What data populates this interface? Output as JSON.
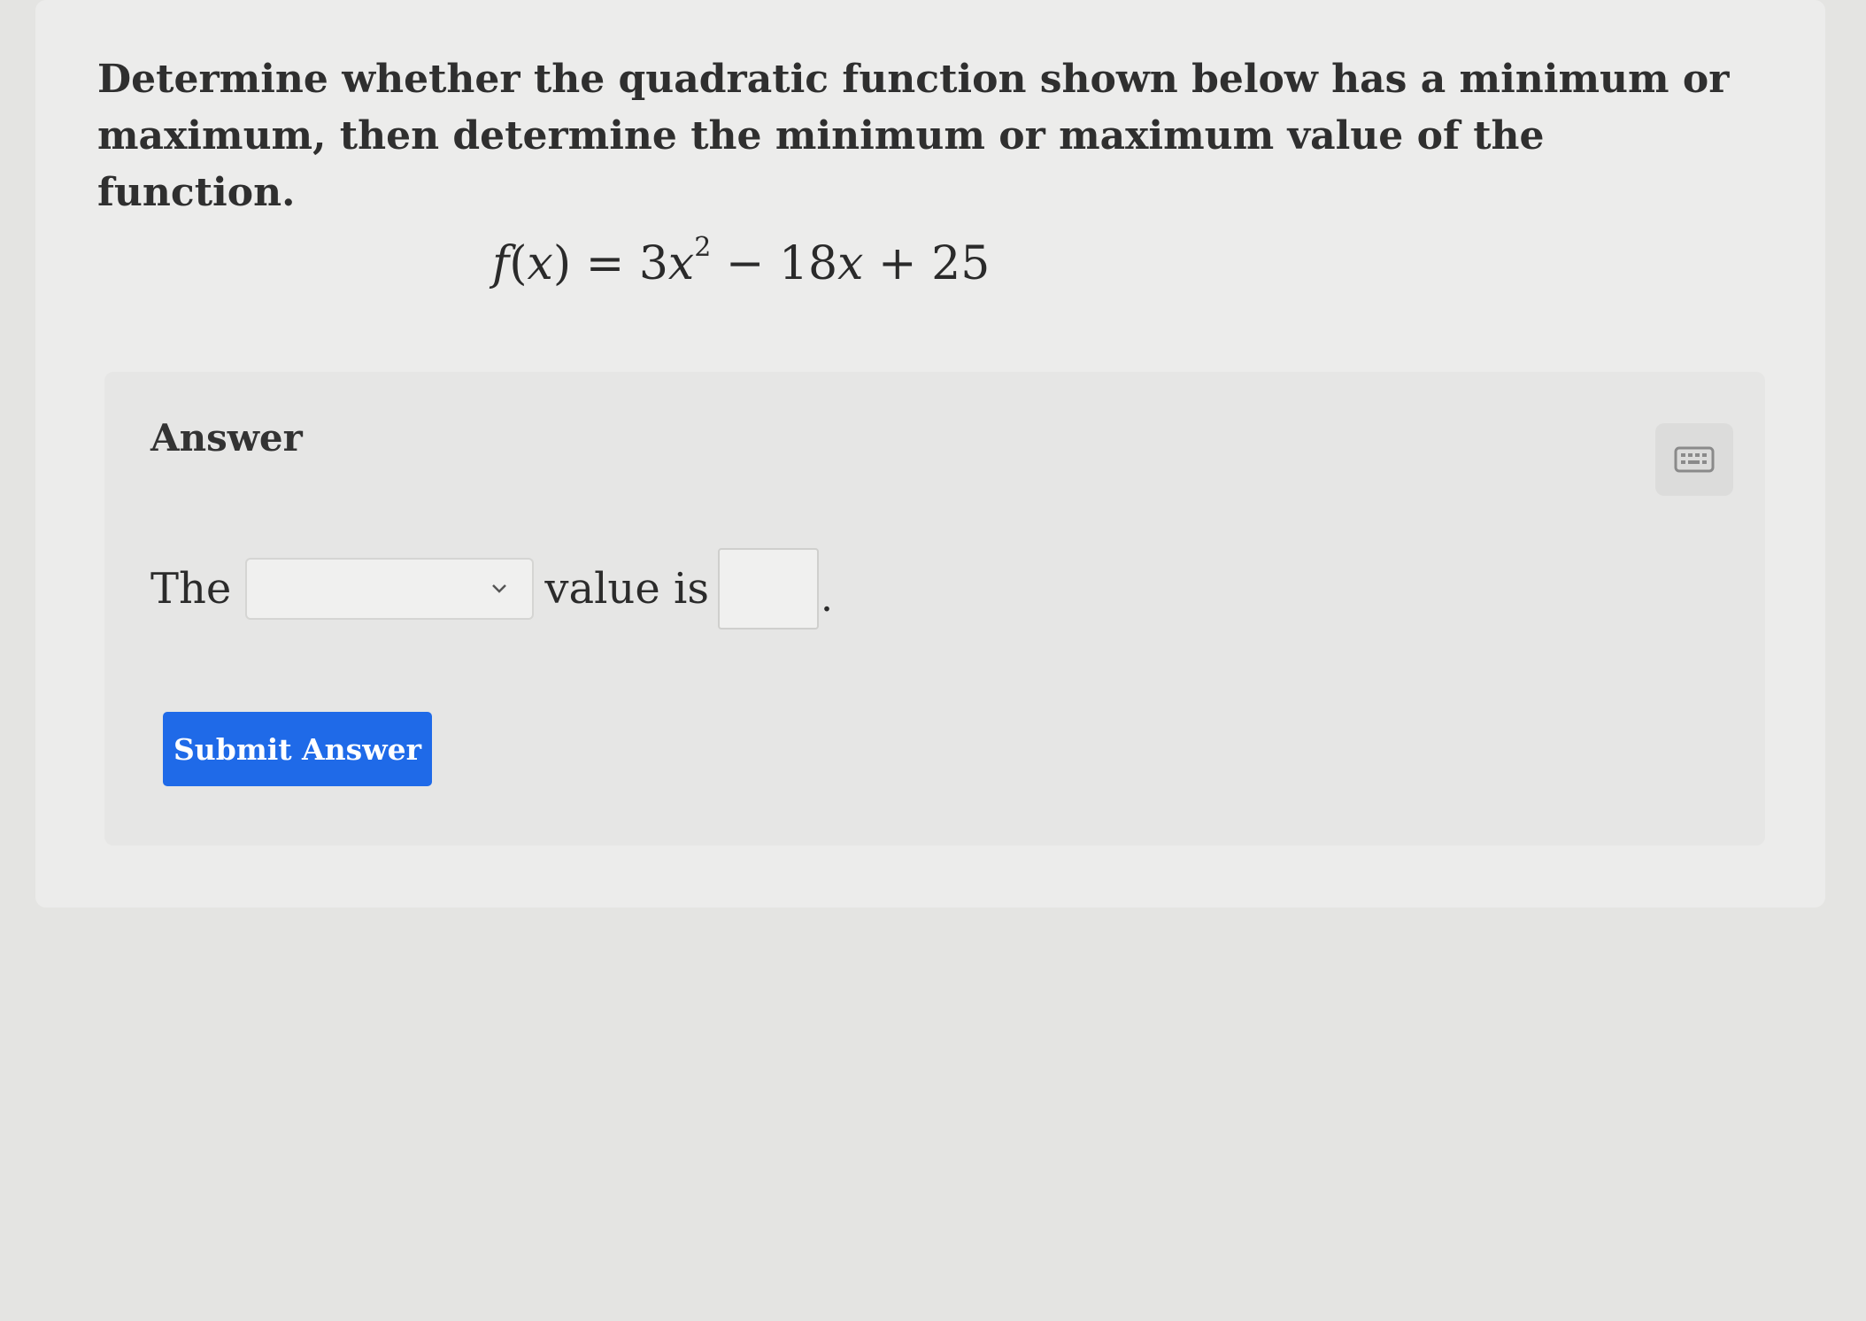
{
  "question": {
    "text": "Determine whether the quadratic function shown below has a minimum or maximum, then determine the minimum or maximum value of the function."
  },
  "formula": {
    "lhs_f": "f",
    "lhs_open": "(",
    "lhs_x": "x",
    "lhs_close": ")",
    "equals": " = ",
    "coef1": "3",
    "var1": "x",
    "exp1": "2",
    "op1": " − ",
    "coef2": "18",
    "var2": "x",
    "op2": " + ",
    "const": "25"
  },
  "answer": {
    "label": "Answer",
    "prefix": "The",
    "select_value": "",
    "middle": "value is",
    "input_value": "",
    "suffix": "."
  },
  "actions": {
    "submit_label": "Submit Answer"
  },
  "icons": {
    "keyboard": "keyboard-icon",
    "dropdown": "chevron-down-icon"
  },
  "colors": {
    "submit_button": "#1f6ae8"
  }
}
